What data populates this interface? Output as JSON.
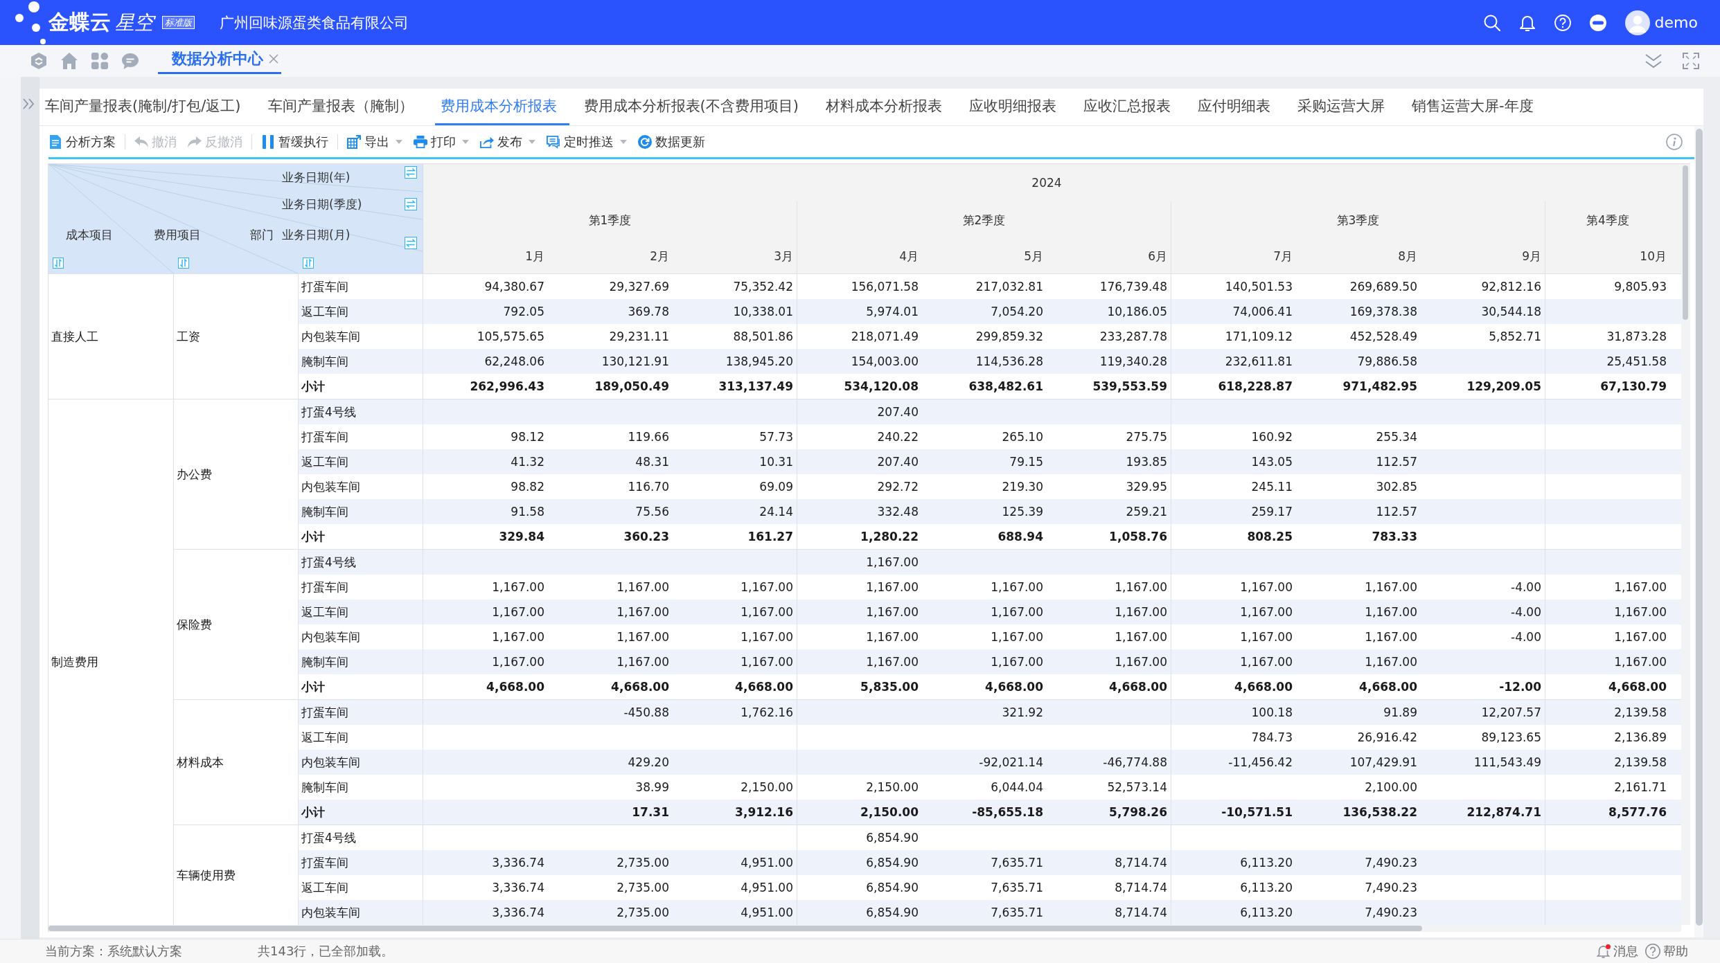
{
  "top_bar": {
    "product_name": "金蝶云",
    "product_suffix": "星空",
    "edition_badge": "标准版",
    "company": "广州回味源蛋类食品有限公司",
    "user": "demo"
  },
  "nav_tabs": [
    {
      "label": "数据分析中心",
      "selected": true,
      "closable": true
    }
  ],
  "report_tabs": [
    {
      "label": "车间产量报表(腌制/打包/返工)",
      "selected": false
    },
    {
      "label": "车间产量报表（腌制）",
      "selected": false
    },
    {
      "label": "费用成本分析报表",
      "selected": true
    },
    {
      "label": "费用成本分析报表(不含费用项目)",
      "selected": false
    },
    {
      "label": "材料成本分析报表",
      "selected": false
    },
    {
      "label": "应收明细报表",
      "selected": false
    },
    {
      "label": "应收汇总报表",
      "selected": false
    },
    {
      "label": "应付明细表",
      "selected": false
    },
    {
      "label": "采购运营大屏",
      "selected": false
    },
    {
      "label": "销售运营大屏-年度",
      "selected": false
    }
  ],
  "toolbar": {
    "groups": [
      [
        {
          "kind": "scheme",
          "label": "分析方案",
          "disabled": false,
          "has_menu": false
        }
      ],
      [
        {
          "kind": "undo",
          "label": "撤消",
          "disabled": true,
          "has_menu": false
        },
        {
          "kind": "redo",
          "label": "反撤消",
          "disabled": true,
          "has_menu": false
        }
      ],
      [
        {
          "kind": "pause",
          "label": "暂缓执行",
          "disabled": false,
          "has_menu": false
        }
      ],
      [
        {
          "kind": "export",
          "label": "导出",
          "disabled": false,
          "has_menu": true
        },
        {
          "kind": "print",
          "label": "打印",
          "disabled": false,
          "has_menu": true
        },
        {
          "kind": "publish",
          "label": "发布",
          "disabled": false,
          "has_menu": true
        },
        {
          "kind": "schedule",
          "label": "定时推送",
          "disabled": false,
          "has_menu": true
        },
        {
          "kind": "refresh",
          "label": "数据更新",
          "disabled": false,
          "has_menu": false
        }
      ]
    ]
  },
  "table": {
    "corner": {
      "column_dimensions": [
        "业务日期(年)",
        "业务日期(季度)",
        "业务日期(月)"
      ],
      "row_dimensions": [
        "成本项目",
        "费用项目",
        "部门"
      ]
    },
    "year": "2024",
    "quarters": [
      {
        "label": "第1季度",
        "months": [
          "1月",
          "2月",
          "3月"
        ]
      },
      {
        "label": "第2季度",
        "months": [
          "4月",
          "5月",
          "6月"
        ]
      },
      {
        "label": "第3季度",
        "months": [
          "7月",
          "8月",
          "9月"
        ]
      },
      {
        "label": "第4季度",
        "months": [
          "10月"
        ]
      }
    ],
    "row_groups": [
      {
        "cost_item": "直接人工",
        "expense_items": [
          {
            "name": "工资",
            "rows": [
              {
                "department": "打蛋车间",
                "kind": "detail",
                "values": {
                  "month_1": "94,380.67",
                  "month_2": "29,327.69",
                  "month_3": "75,352.42",
                  "month_4": "156,071.58",
                  "month_5": "217,032.81",
                  "month_6": "176,739.48",
                  "month_7": "140,501.53",
                  "month_8": "269,689.50",
                  "month_9": "92,812.16",
                  "month_10": "9,805.93"
                }
              },
              {
                "department": "返工车间",
                "kind": "detail",
                "values": {
                  "month_1": "792.05",
                  "month_2": "369.78",
                  "month_3": "10,338.01",
                  "month_4": "5,974.01",
                  "month_5": "7,054.20",
                  "month_6": "10,186.05",
                  "month_7": "74,006.41",
                  "month_8": "169,378.38",
                  "month_9": "30,544.18"
                }
              },
              {
                "department": "内包装车间",
                "kind": "detail",
                "values": {
                  "month_1": "105,575.65",
                  "month_2": "29,231.11",
                  "month_3": "88,501.86",
                  "month_4": "218,071.49",
                  "month_5": "299,859.32",
                  "month_6": "233,287.78",
                  "month_7": "171,109.12",
                  "month_8": "452,528.49",
                  "month_9": "5,852.71",
                  "month_10": "31,873.28"
                }
              },
              {
                "department": "腌制车间",
                "kind": "detail",
                "values": {
                  "month_1": "62,248.06",
                  "month_2": "130,121.91",
                  "month_3": "138,945.20",
                  "month_4": "154,003.00",
                  "month_5": "114,536.28",
                  "month_6": "119,340.28",
                  "month_7": "232,611.81",
                  "month_8": "79,886.58",
                  "month_10": "25,451.58"
                }
              },
              {
                "department": "小计",
                "kind": "subtotal",
                "values": {
                  "month_1": "262,996.43",
                  "month_2": "189,050.49",
                  "month_3": "313,137.49",
                  "month_4": "534,120.08",
                  "month_5": "638,482.61",
                  "month_6": "539,553.59",
                  "month_7": "618,228.87",
                  "month_8": "971,482.95",
                  "month_9": "129,209.05",
                  "month_10": "67,130.79"
                }
              }
            ]
          }
        ]
      },
      {
        "cost_item": "制造费用",
        "expense_items": [
          {
            "name": "办公费",
            "rows": [
              {
                "department": "打蛋4号线",
                "kind": "detail",
                "values": {
                  "month_4": "207.40"
                }
              },
              {
                "department": "打蛋车间",
                "kind": "detail",
                "values": {
                  "month_1": "98.12",
                  "month_2": "119.66",
                  "month_3": "57.73",
                  "month_4": "240.22",
                  "month_5": "265.10",
                  "month_6": "275.75",
                  "month_7": "160.92",
                  "month_8": "255.34"
                }
              },
              {
                "department": "返工车间",
                "kind": "detail",
                "values": {
                  "month_1": "41.32",
                  "month_2": "48.31",
                  "month_3": "10.31",
                  "month_4": "207.40",
                  "month_5": "79.15",
                  "month_6": "193.85",
                  "month_7": "143.05",
                  "month_8": "112.57"
                }
              },
              {
                "department": "内包装车间",
                "kind": "detail",
                "values": {
                  "month_1": "98.82",
                  "month_2": "116.70",
                  "month_3": "69.09",
                  "month_4": "292.72",
                  "month_5": "219.30",
                  "month_6": "329.95",
                  "month_7": "245.11",
                  "month_8": "302.85"
                }
              },
              {
                "department": "腌制车间",
                "kind": "detail",
                "values": {
                  "month_1": "91.58",
                  "month_2": "75.56",
                  "month_3": "24.14",
                  "month_4": "332.48",
                  "month_5": "125.39",
                  "month_6": "259.21",
                  "month_7": "259.17",
                  "month_8": "112.57"
                }
              },
              {
                "department": "小计",
                "kind": "subtotal",
                "values": {
                  "month_1": "329.84",
                  "month_2": "360.23",
                  "month_3": "161.27",
                  "month_4": "1,280.22",
                  "month_5": "688.94",
                  "month_6": "1,058.76",
                  "month_7": "808.25",
                  "month_8": "783.33"
                }
              }
            ]
          },
          {
            "name": "保险费",
            "rows": [
              {
                "department": "打蛋4号线",
                "kind": "detail",
                "values": {
                  "month_4": "1,167.00"
                }
              },
              {
                "department": "打蛋车间",
                "kind": "detail",
                "values": {
                  "month_1": "1,167.00",
                  "month_2": "1,167.00",
                  "month_3": "1,167.00",
                  "month_4": "1,167.00",
                  "month_5": "1,167.00",
                  "month_6": "1,167.00",
                  "month_7": "1,167.00",
                  "month_8": "1,167.00",
                  "month_9": "-4.00",
                  "month_10": "1,167.00"
                }
              },
              {
                "department": "返工车间",
                "kind": "detail",
                "values": {
                  "month_1": "1,167.00",
                  "month_2": "1,167.00",
                  "month_3": "1,167.00",
                  "month_4": "1,167.00",
                  "month_5": "1,167.00",
                  "month_6": "1,167.00",
                  "month_7": "1,167.00",
                  "month_8": "1,167.00",
                  "month_9": "-4.00",
                  "month_10": "1,167.00"
                }
              },
              {
                "department": "内包装车间",
                "kind": "detail",
                "values": {
                  "month_1": "1,167.00",
                  "month_2": "1,167.00",
                  "month_3": "1,167.00",
                  "month_4": "1,167.00",
                  "month_5": "1,167.00",
                  "month_6": "1,167.00",
                  "month_7": "1,167.00",
                  "month_8": "1,167.00",
                  "month_9": "-4.00",
                  "month_10": "1,167.00"
                }
              },
              {
                "department": "腌制车间",
                "kind": "detail",
                "values": {
                  "month_1": "1,167.00",
                  "month_2": "1,167.00",
                  "month_3": "1,167.00",
                  "month_4": "1,167.00",
                  "month_5": "1,167.00",
                  "month_6": "1,167.00",
                  "month_7": "1,167.00",
                  "month_8": "1,167.00",
                  "month_10": "1,167.00"
                }
              },
              {
                "department": "小计",
                "kind": "subtotal",
                "values": {
                  "month_1": "4,668.00",
                  "month_2": "4,668.00",
                  "month_3": "4,668.00",
                  "month_4": "5,835.00",
                  "month_5": "4,668.00",
                  "month_6": "4,668.00",
                  "month_7": "4,668.00",
                  "month_8": "4,668.00",
                  "month_9": "-12.00",
                  "month_10": "4,668.00"
                }
              }
            ]
          },
          {
            "name": "材料成本",
            "rows": [
              {
                "department": "打蛋车间",
                "kind": "detail",
                "values": {
                  "month_2": "-450.88",
                  "month_3": "1,762.16",
                  "month_5": "321.92",
                  "month_7": "100.18",
                  "month_8": "91.89",
                  "month_9": "12,207.57",
                  "month_10": "2,139.58"
                }
              },
              {
                "department": "返工车间",
                "kind": "detail",
                "values": {
                  "month_7": "784.73",
                  "month_8": "26,916.42",
                  "month_9": "89,123.65",
                  "month_10": "2,136.89"
                }
              },
              {
                "department": "内包装车间",
                "kind": "detail",
                "values": {
                  "month_2": "429.20",
                  "month_5": "-92,021.14",
                  "month_6": "-46,774.88",
                  "month_7": "-11,456.42",
                  "month_8": "107,429.91",
                  "month_9": "111,543.49",
                  "month_10": "2,139.58"
                }
              },
              {
                "department": "腌制车间",
                "kind": "detail",
                "values": {
                  "month_2": "38.99",
                  "month_3": "2,150.00",
                  "month_4": "2,150.00",
                  "month_5": "6,044.04",
                  "month_6": "52,573.14",
                  "month_8": "2,100.00",
                  "month_10": "2,161.71"
                }
              },
              {
                "department": "小计",
                "kind": "subtotal",
                "values": {
                  "month_2": "17.31",
                  "month_3": "3,912.16",
                  "month_4": "2,150.00",
                  "month_5": "-85,655.18",
                  "month_6": "5,798.26",
                  "month_7": "-10,571.51",
                  "month_8": "136,538.22",
                  "month_9": "212,874.71",
                  "month_10": "8,577.76"
                }
              }
            ]
          },
          {
            "name": "车辆使用费",
            "rows": [
              {
                "department": "打蛋4号线",
                "kind": "detail",
                "values": {
                  "month_4": "6,854.90"
                }
              },
              {
                "department": "打蛋车间",
                "kind": "detail",
                "values": {
                  "month_1": "3,336.74",
                  "month_2": "2,735.00",
                  "month_3": "4,951.00",
                  "month_4": "6,854.90",
                  "month_5": "7,635.71",
                  "month_6": "8,714.74",
                  "month_7": "6,113.20",
                  "month_8": "7,490.23"
                }
              },
              {
                "department": "返工车间",
                "kind": "detail",
                "values": {
                  "month_1": "3,336.74",
                  "month_2": "2,735.00",
                  "month_3": "4,951.00",
                  "month_4": "6,854.90",
                  "month_5": "7,635.71",
                  "month_6": "8,714.74",
                  "month_7": "6,113.20",
                  "month_8": "7,490.23"
                }
              },
              {
                "department": "内包装车间",
                "kind": "detail",
                "values": {
                  "month_1": "3,336.74",
                  "month_2": "2,735.00",
                  "month_3": "4,951.00",
                  "month_4": "6,854.90",
                  "month_5": "7,635.71",
                  "month_6": "8,714.74",
                  "month_7": "6,113.20",
                  "month_8": "7,490.23"
                }
              }
            ]
          }
        ]
      }
    ]
  },
  "status_bar": {
    "scheme": "当前方案：系统默认方案",
    "row_count": "共143行，已全部加载。",
    "links": [
      {
        "kind": "messages",
        "label": "消息",
        "unread": true
      },
      {
        "kind": "help",
        "label": "帮助",
        "unread": false
      }
    ]
  }
}
